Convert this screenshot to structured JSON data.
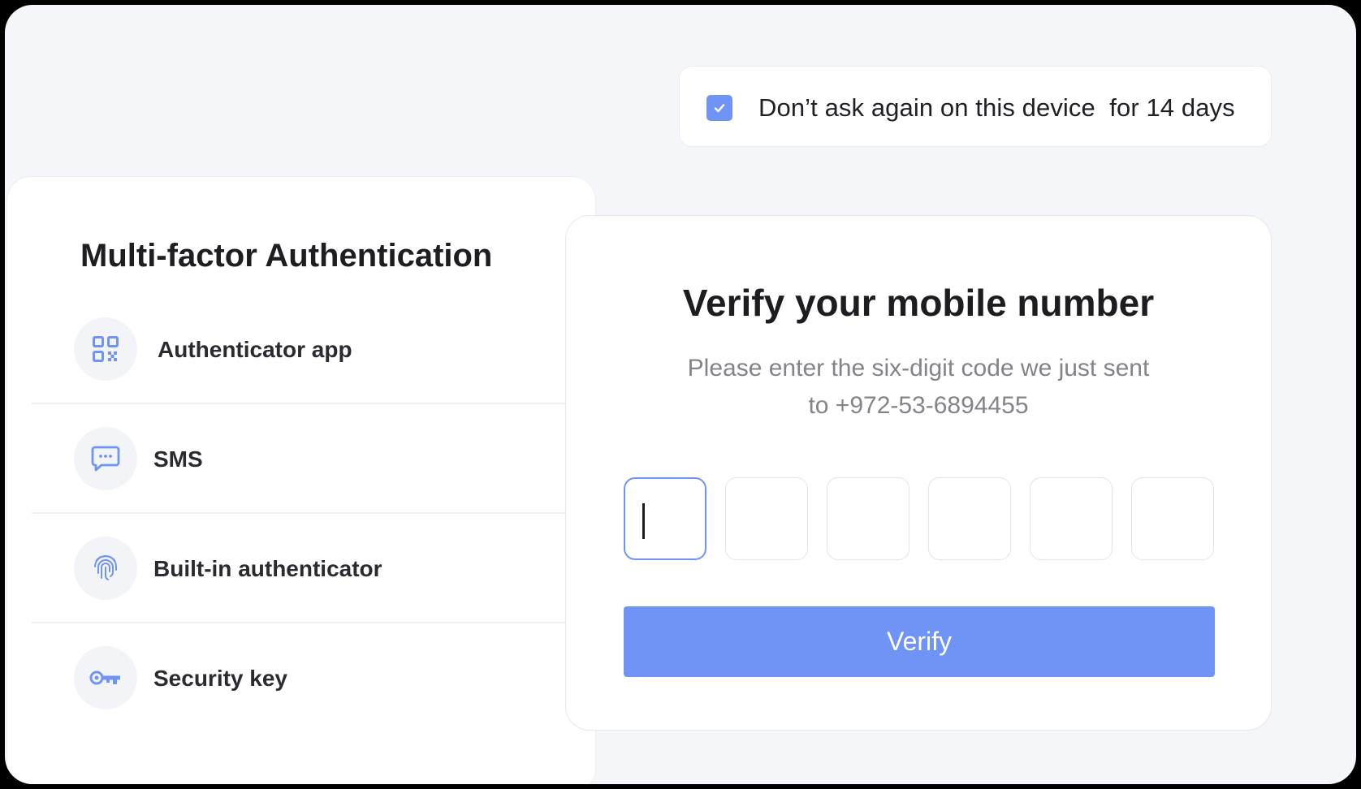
{
  "colors": {
    "accent": "#6f94f6",
    "background": "#f5f6f9",
    "card": "#ffffff",
    "text_primary": "#1d1e22",
    "text_secondary": "#82848a",
    "icon_bg": "#f2f4f8"
  },
  "remember": {
    "checked": true,
    "label": "Don’t ask again on this device  for 14 days"
  },
  "mfa": {
    "title": "Multi-factor Authentication",
    "methods": [
      {
        "label": "Authenticator app",
        "icon": "qr-code-icon"
      },
      {
        "label": "SMS",
        "icon": "message-icon"
      },
      {
        "label": "Built-in authenticator",
        "icon": "fingerprint-icon"
      },
      {
        "label": "Security key",
        "icon": "key-icon"
      }
    ]
  },
  "verify": {
    "title": "Verify your mobile number",
    "description_line1": "Please enter the six-digit code we just sent",
    "description_line2": "to +972-53-6894455",
    "code_digits": [
      "",
      "",
      "",
      "",
      "",
      ""
    ],
    "button_label": "Verify"
  }
}
